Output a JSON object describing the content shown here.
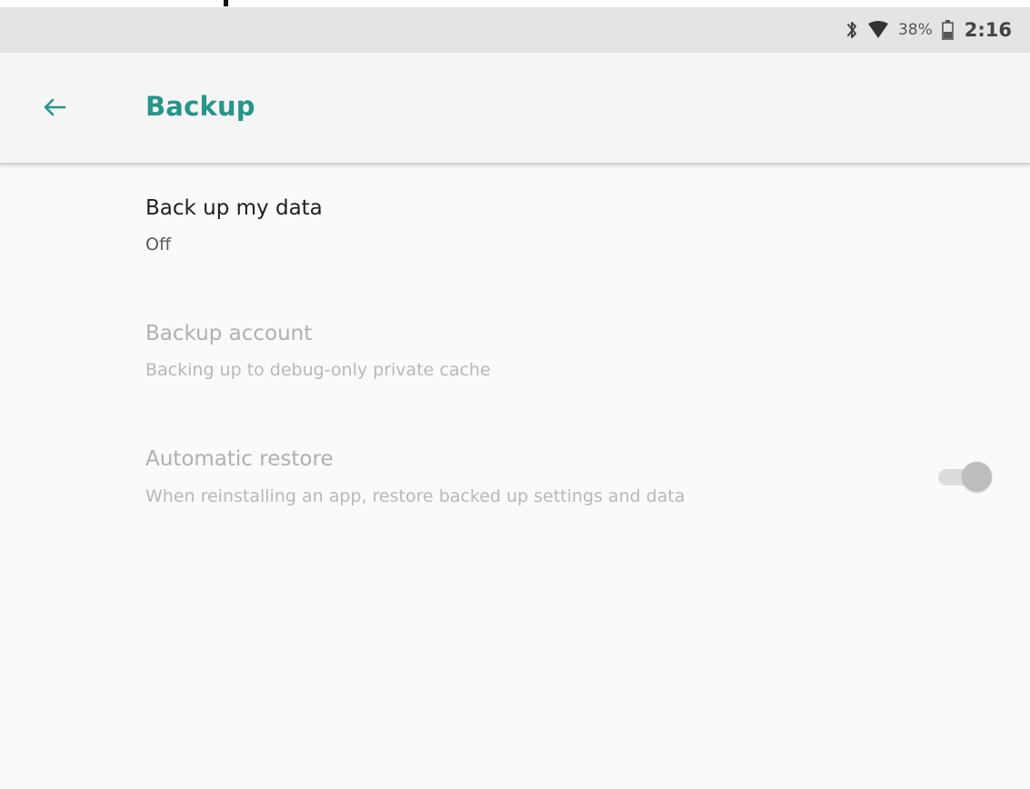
{
  "status_bar": {
    "icons": [
      "bluetooth-icon",
      "wifi-icon",
      "battery-icon"
    ],
    "battery_percent": "38%",
    "time": "2:16"
  },
  "app_bar": {
    "back_icon": "arrow-back-icon",
    "title": "Backup"
  },
  "preferences": [
    {
      "title": "Back up my data",
      "summary": "Off",
      "enabled": true
    },
    {
      "title": "Backup account",
      "summary": "Backing up to debug-only private cache",
      "enabled": false
    },
    {
      "title": "Automatic restore",
      "summary": "When reinstalling an app, restore backed up settings and data",
      "enabled": false,
      "toggle_on": true
    }
  ],
  "colors": {
    "accent": "#26958a",
    "status_bar_bg": "#e4e4e4",
    "app_bar_bg": "#f5f5f5",
    "content_bg": "#fafafa"
  }
}
